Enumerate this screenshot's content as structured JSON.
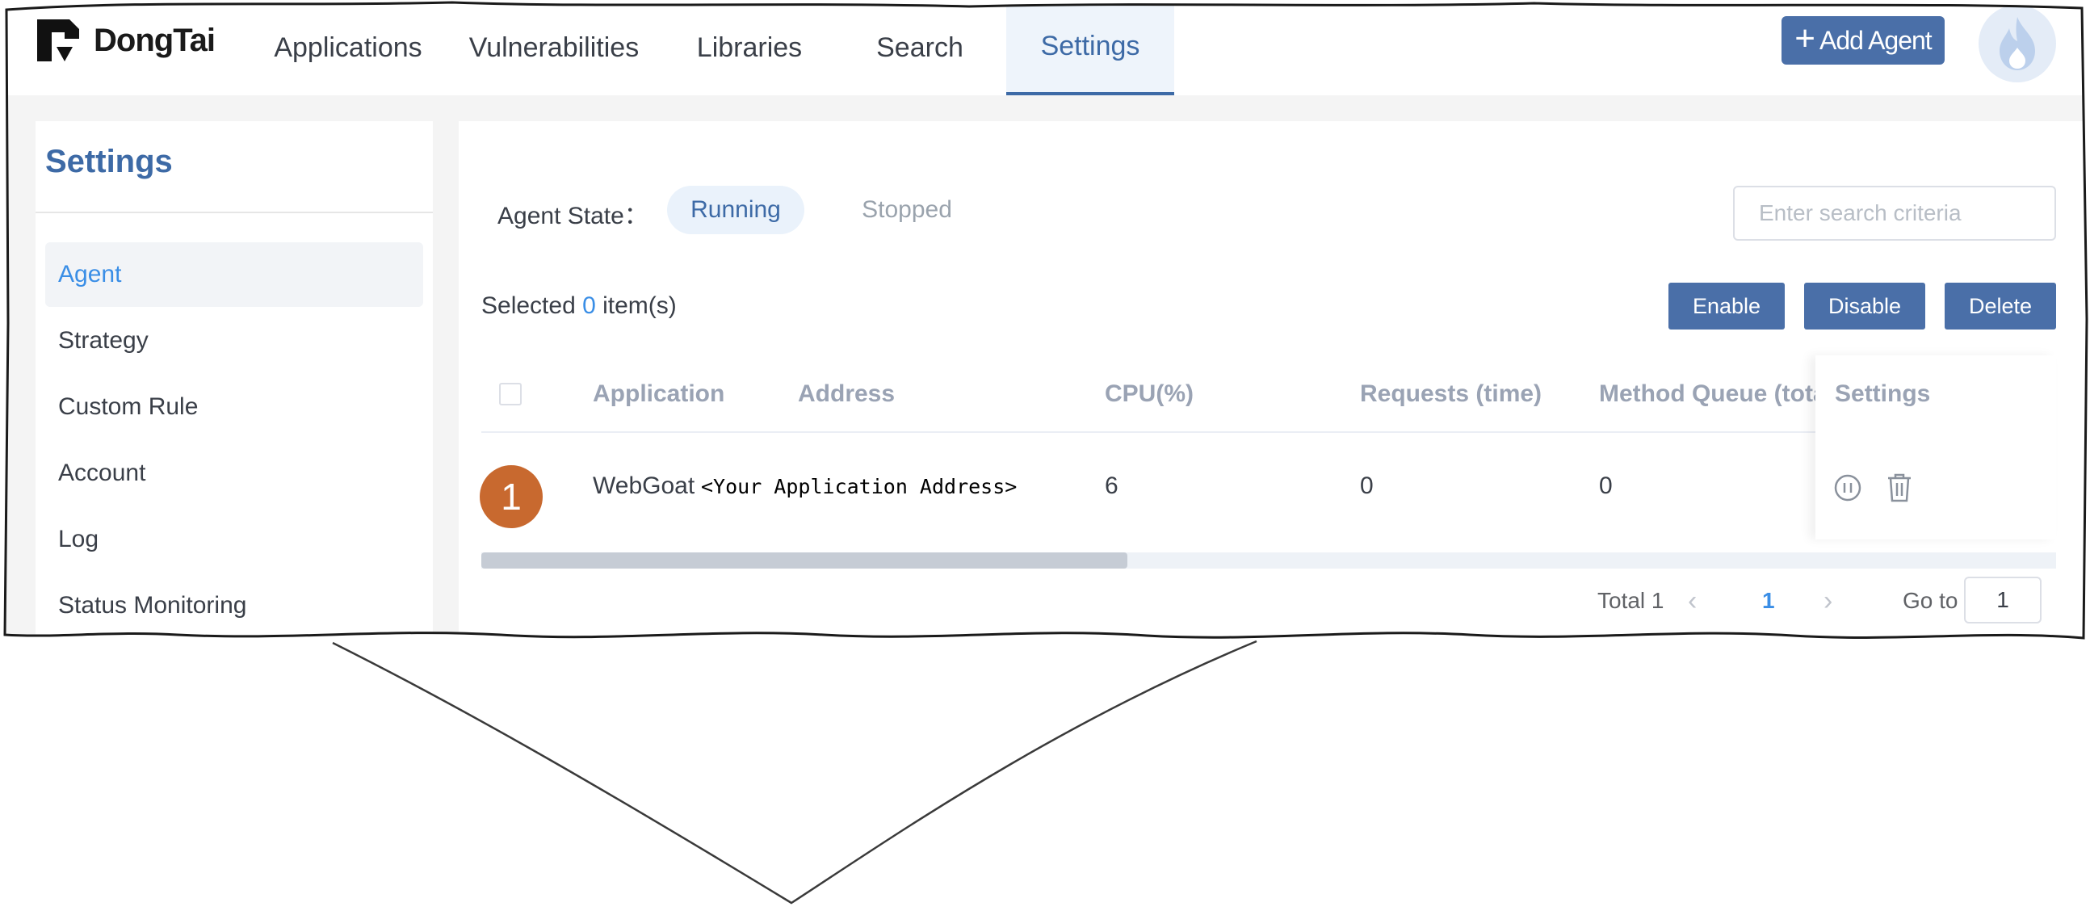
{
  "brand": {
    "name": "DongTai"
  },
  "nav": {
    "items": [
      {
        "label": "Applications"
      },
      {
        "label": "Vulnerabilities"
      },
      {
        "label": "Libraries"
      },
      {
        "label": "Search"
      },
      {
        "label": "Settings",
        "active": true
      }
    ],
    "add_agent_label": "Add Agent",
    "add_agent_icon": "plus-icon",
    "avatar_icon": "flame-icon"
  },
  "sidebar": {
    "title": "Settings",
    "items": [
      {
        "label": "Agent",
        "active": true
      },
      {
        "label": "Strategy"
      },
      {
        "label": "Custom Rule"
      },
      {
        "label": "Account"
      },
      {
        "label": "Log"
      },
      {
        "label": "Status Monitoring"
      }
    ]
  },
  "filter": {
    "state_label": "Agent State：",
    "running_label": "Running",
    "stopped_label": "Stopped",
    "search_placeholder": "Enter search criteria"
  },
  "selection": {
    "prefix": "Selected",
    "count": "0",
    "suffix": "item(s)"
  },
  "actions": {
    "enable": "Enable",
    "disable": "Disable",
    "delete": "Delete"
  },
  "table": {
    "columns": [
      "Application",
      "Address",
      "CPU(%)",
      "Requests (time)",
      "Method Queue (tota",
      "Settings"
    ],
    "rows": [
      {
        "badge": "1",
        "application": "WebGoat",
        "address": "<Your Application Address>",
        "cpu": "6",
        "requests": "0",
        "method_queue": "0",
        "actions_icons": [
          "pause-icon",
          "trash-icon"
        ]
      }
    ]
  },
  "pagination": {
    "total_label": "Total 1",
    "current_page": "1",
    "goto_label": "Go to",
    "goto_value": "1"
  },
  "colors": {
    "accent": "#3d6aa6",
    "button": "#4a6fa8",
    "link": "#3a8ee6",
    "badge": "#c8692f"
  }
}
